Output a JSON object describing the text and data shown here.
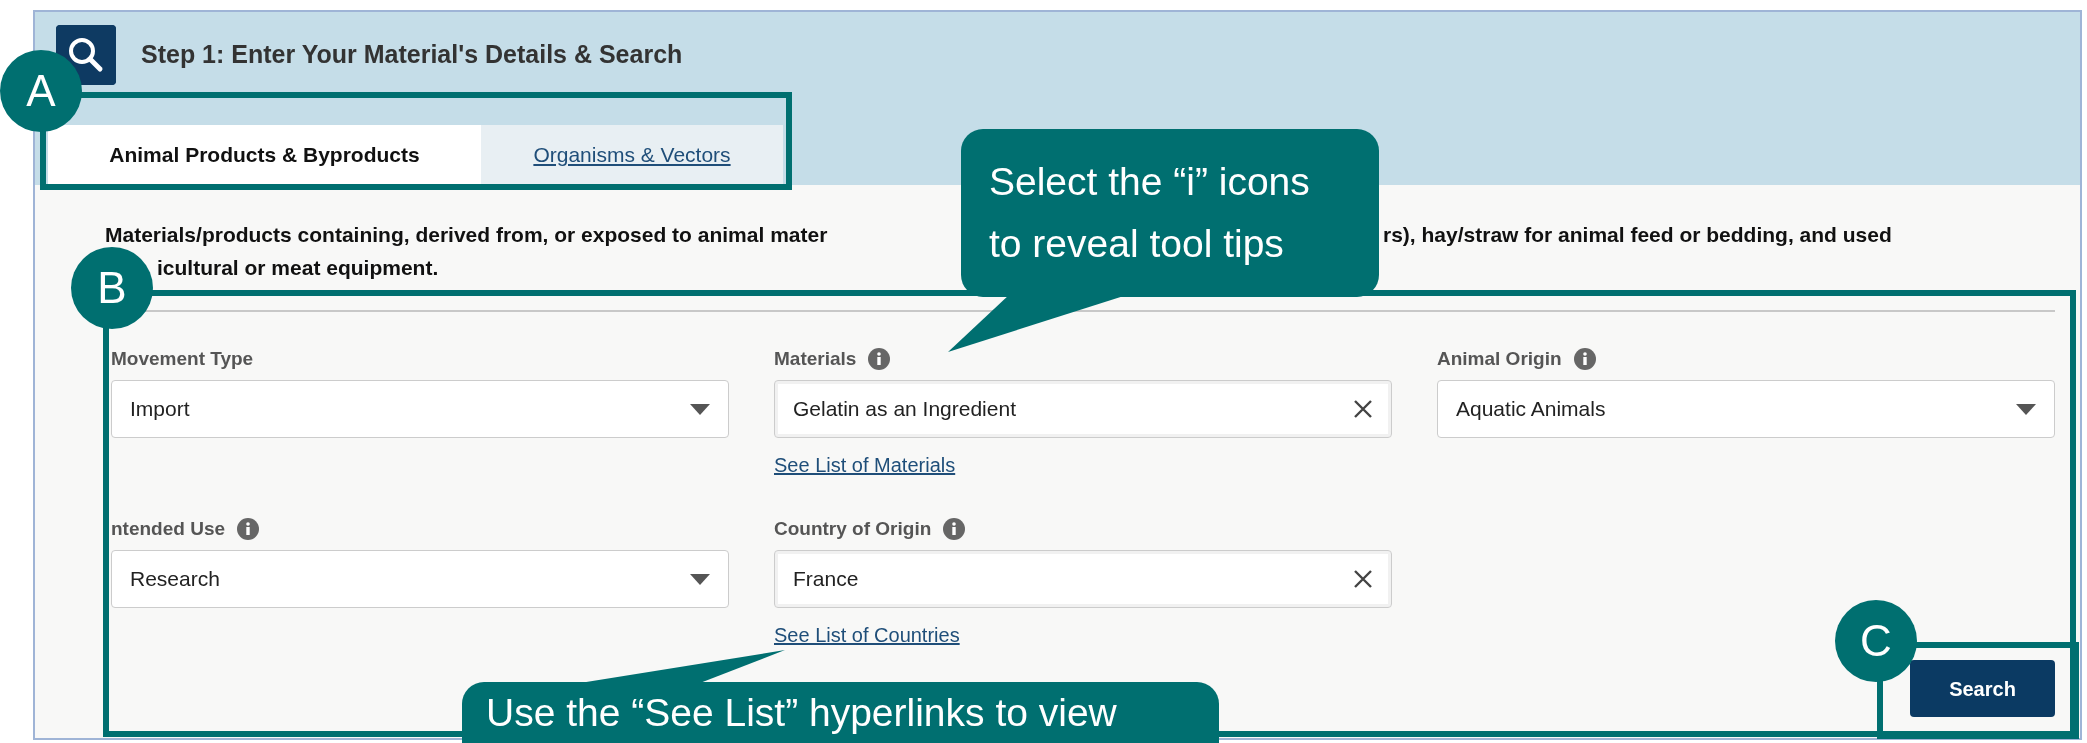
{
  "header": {
    "title": "Step 1: Enter Your Material's Details & Search"
  },
  "tabs": [
    {
      "label": "Animal Products & Byproducts",
      "selected": true
    },
    {
      "label": "Organisms & Vectors",
      "selected": false
    }
  ],
  "description": {
    "line_1_start": "Materials/products containing, derived from, or exposed to animal mater",
    "line_1_end": "rs), hay/straw for animal feed or bedding, and used",
    "line_2": "icultural or meat equipment."
  },
  "fields": [
    {
      "kind": "select",
      "label": "Movement Type",
      "info": false,
      "value": "Import"
    },
    {
      "kind": "clearable",
      "label": "Materials",
      "info": true,
      "value": "Gelatin as an Ingredient",
      "link": "See List of Materials"
    },
    {
      "kind": "select",
      "label": "Animal Origin",
      "info": true,
      "value": "Aquatic Animals"
    },
    {
      "kind": "select",
      "label": "ntended Use",
      "info": true,
      "value": "Research"
    },
    {
      "kind": "clearable",
      "label": "Country of Origin",
      "info": true,
      "value": "France",
      "link": "See List of Countries"
    }
  ],
  "search_button": "Search",
  "annotations": {
    "markers": [
      {
        "letter": "A"
      },
      {
        "letter": "B"
      },
      {
        "letter": "C"
      }
    ],
    "callouts": [
      {
        "text": "Select the “i” icons to reveal tool tips"
      },
      {
        "text": "Use the “See List” hyperlinks to view"
      }
    ]
  }
}
